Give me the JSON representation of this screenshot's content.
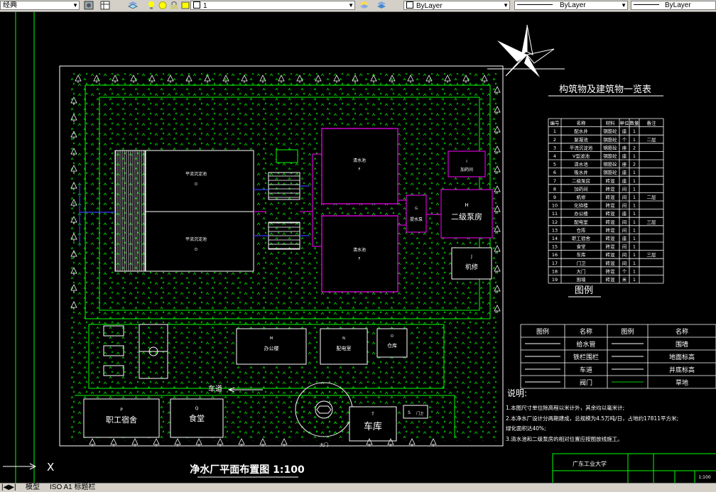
{
  "toolbar": {
    "style_combo": "经典",
    "layer_combo": "1",
    "color_combo": "ByLayer",
    "linetype_combo": "ByLayer",
    "lineweight_combo": "ByLayer"
  },
  "drawing": {
    "title": "净水厂平面布置图 1:100",
    "buildings": {
      "sed_tank_1": "平流沉淀池",
      "sed_tank_1_code": "D",
      "sed_tank_2": "平流沉淀池",
      "sed_tank_2_code": "D",
      "clear_tank_1": "清水池",
      "clear_tank_1_code": "F",
      "clear_tank_2": "清水池",
      "clear_tank_2_code": "F",
      "dosing": "加药间",
      "dosing_code": "I",
      "lift_pump": "提水泵",
      "lift_pump_code": "G",
      "pump_house": "二级泵房",
      "pump_house_code": "H",
      "garage_small": "机修",
      "garage_small_code": "J",
      "office": "办公楼",
      "office_code": "M",
      "substation": "配电室",
      "substation_code": "N",
      "storage": "仓库",
      "storage_code": "O",
      "dorm": "职工宿舍",
      "dorm_code": "P",
      "canteen": "食堂",
      "canteen_code": "Q",
      "garage": "车库",
      "garage_code": "T",
      "guard": "门卫",
      "guard_code": "S",
      "road_label": "车道",
      "gate_label": "大门"
    },
    "schedule": {
      "title": "构筑物及建筑物一览表",
      "headers": [
        "编号",
        "名称",
        "材料",
        "单位",
        "数量",
        "备注"
      ],
      "rows": [
        [
          "1",
          "配水井",
          "钢筋砼",
          "座",
          "1",
          ""
        ],
        [
          "2",
          "絮凝池",
          "钢筋砼",
          "个",
          "1",
          "二层"
        ],
        [
          "3",
          "平流沉淀池",
          "钢筋砼",
          "座",
          "2",
          ""
        ],
        [
          "4",
          "V型滤池",
          "钢筋砼",
          "座",
          "1",
          ""
        ],
        [
          "5",
          "清水池",
          "钢筋砼",
          "座",
          "2",
          ""
        ],
        [
          "6",
          "吸水井",
          "钢筋砼",
          "座",
          "1",
          ""
        ],
        [
          "7",
          "二级泵房",
          "砖混",
          "座",
          "1",
          ""
        ],
        [
          "8",
          "加药间",
          "砖混",
          "间",
          "1",
          ""
        ],
        [
          "9",
          "机修",
          "砖混",
          "间",
          "1",
          "二层"
        ],
        [
          "10",
          "化验楼",
          "砖混",
          "间",
          "1",
          ""
        ],
        [
          "11",
          "办公楼",
          "砖混",
          "座",
          "1",
          ""
        ],
        [
          "12",
          "配电室",
          "砖混",
          "间",
          "1",
          "三层"
        ],
        [
          "13",
          "仓库",
          "砖混",
          "间",
          "1",
          ""
        ],
        [
          "14",
          "职工宿舍",
          "砖混",
          "座",
          "1",
          ""
        ],
        [
          "15",
          "食堂",
          "砖混",
          "间",
          "1",
          ""
        ],
        [
          "16",
          "车库",
          "砖混",
          "间",
          "1",
          "三层"
        ],
        [
          "17",
          "门卫",
          "砖混",
          "间",
          "1",
          ""
        ],
        [
          "18",
          "大门",
          "砖混",
          "个",
          "1",
          ""
        ],
        [
          "19",
          "围墙",
          "砖混",
          "米",
          "1",
          ""
        ]
      ]
    },
    "legend": {
      "title": "图例",
      "headers": [
        "图例",
        "名称",
        "图例",
        "名称"
      ],
      "items": [
        [
          "给水管",
          "围墙"
        ],
        [
          "铁栏围栏",
          "地面标高"
        ],
        [
          "车道",
          "井底标高"
        ],
        [
          "阀门",
          "草地"
        ]
      ]
    },
    "notes": {
      "title": "说明:",
      "lines": [
        "1.本图尺寸单位除高程以米计外，其余均以毫米计;",
        "2.本净水厂设计分两期建成，总规模为4.5万吨/日，占地约17811平方米;",
        "  绿化面积达40%;",
        "3.清水池和二级泵房的相对位置应按图放线施工。"
      ]
    },
    "titleblock": {
      "school": "广东工业大学",
      "scale": "1:100"
    }
  },
  "layout_tabs": [
    "模型",
    "ISO A1 标题栏"
  ],
  "colors": {
    "boundary": "#00ff00",
    "building": "#ffffff",
    "pipe": "#ff00ff",
    "water_line": "#3a3aff",
    "grass": "#00cc00",
    "background": "#000000",
    "toolbar": "#d4d0c8"
  }
}
